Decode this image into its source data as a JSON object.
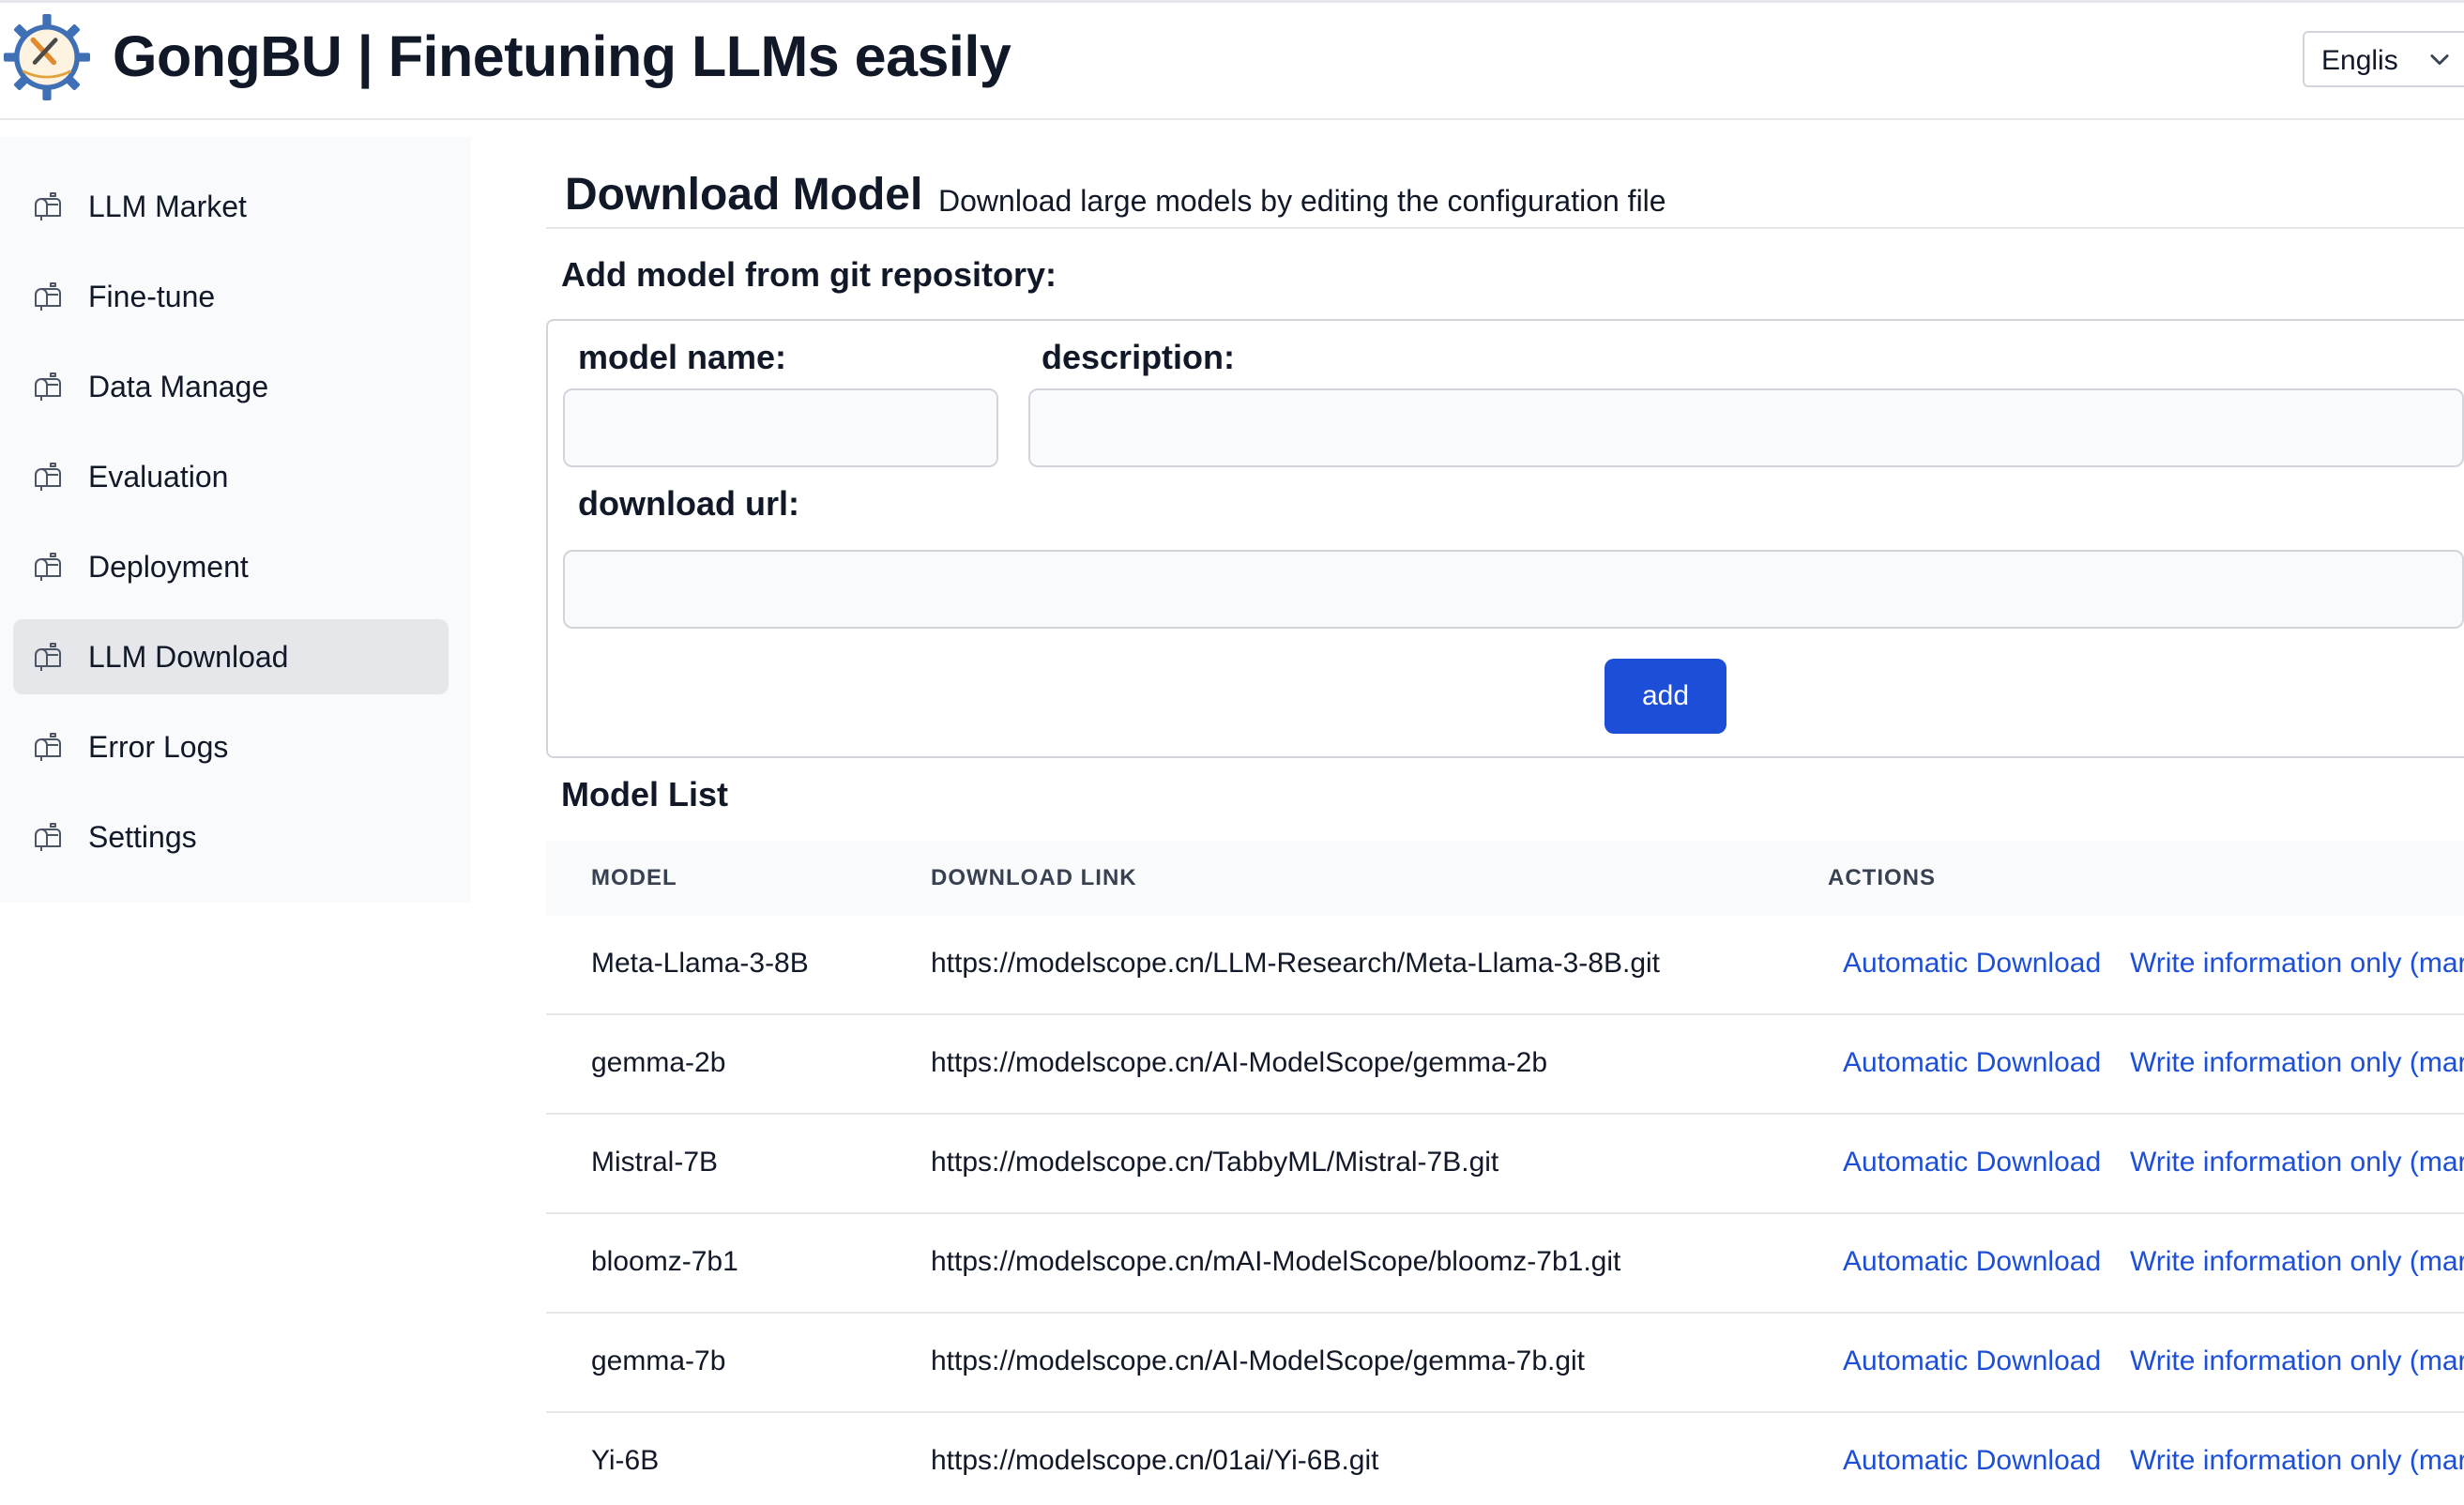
{
  "header": {
    "title": "GongBU | Finetuning LLMs easily",
    "logo_text": "GongBU",
    "language": "Englis"
  },
  "sidebar": {
    "items": [
      {
        "label": "LLM Market",
        "active": false
      },
      {
        "label": "Fine-tune",
        "active": false
      },
      {
        "label": "Data Manage",
        "active": false
      },
      {
        "label": "Evaluation",
        "active": false
      },
      {
        "label": "Deployment",
        "active": false
      },
      {
        "label": "LLM Download",
        "active": true
      },
      {
        "label": "Error Logs",
        "active": false
      },
      {
        "label": "Settings",
        "active": false
      }
    ]
  },
  "main": {
    "title": "Download Model",
    "subtitle": "Download large models by editing the configuration file",
    "form": {
      "heading": "Add model from git repository:",
      "model_name_label": "model name:",
      "model_name_value": "",
      "description_label": "description:",
      "description_value": "",
      "download_url_label": "download url:",
      "download_url_value": "",
      "add_button": "add"
    },
    "model_list": {
      "heading": "Model List",
      "columns": [
        "MODEL",
        "DOWNLOAD LINK",
        "ACTIONS"
      ],
      "rows": [
        {
          "model": "Meta-Llama-3-8B",
          "link": "https://modelscope.cn/LLM-Research/Meta-Llama-3-8B.git",
          "action1": "Automatic Download",
          "action2": "Write information only (mar"
        },
        {
          "model": "gemma-2b",
          "link": "https://modelscope.cn/AI-ModelScope/gemma-2b",
          "action1": "Automatic Download",
          "action2": "Write information only (mar"
        },
        {
          "model": "Mistral-7B",
          "link": "https://modelscope.cn/TabbyML/Mistral-7B.git",
          "action1": "Automatic Download",
          "action2": "Write information only (mar"
        },
        {
          "model": "bloomz-7b1",
          "link": "https://modelscope.cn/mAI-ModelScope/bloomz-7b1.git",
          "action1": "Automatic Download",
          "action2": "Write information only (mar"
        },
        {
          "model": "gemma-7b",
          "link": "https://modelscope.cn/AI-ModelScope/gemma-7b.git",
          "action1": "Automatic Download",
          "action2": "Write information only (mar"
        },
        {
          "model": "Yi-6B",
          "link": "https://modelscope.cn/01ai/Yi-6B.git",
          "action1": "Automatic Download",
          "action2": "Write information only (mar"
        }
      ]
    }
  },
  "colors": {
    "accent": "#1d4ed8",
    "sidebar_bg": "#f9fafb",
    "active_item_bg": "#e5e7eb"
  },
  "icons": {
    "logo": "gear-logo-icon",
    "nav": "mailbox-icon",
    "language": "chevron-down-icon"
  }
}
